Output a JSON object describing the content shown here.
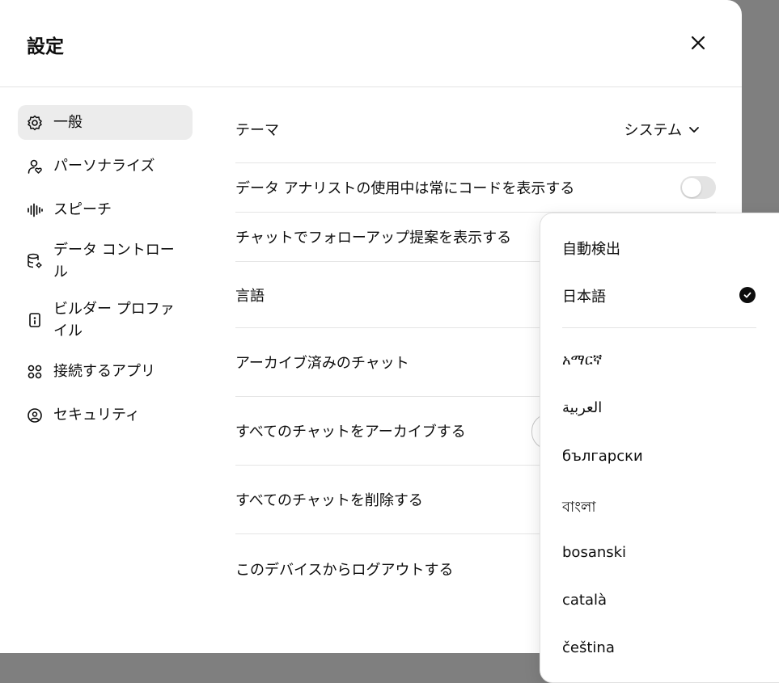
{
  "dialog": {
    "title": "設定"
  },
  "sidebar": {
    "items": [
      {
        "label": "一般",
        "icon": "gear-icon",
        "active": true
      },
      {
        "label": "パーソナライズ",
        "icon": "person-heart-icon"
      },
      {
        "label": "スピーチ",
        "icon": "waveform-icon"
      },
      {
        "label": "データ コントロール",
        "icon": "database-gear-icon"
      },
      {
        "label": "ビルダー プロファイル",
        "icon": "id-badge-icon"
      },
      {
        "label": "接続するアプリ",
        "icon": "apps-grid-icon"
      },
      {
        "label": "セキュリティ",
        "icon": "shield-lock-icon"
      }
    ]
  },
  "settings": {
    "theme": {
      "label": "テーマ",
      "value": "システム"
    },
    "code": {
      "label": "データ アナリストの使用中は常にコードを表示する",
      "enabled": false
    },
    "follow": {
      "label": "チャットでフォローアップ提案を表示する"
    },
    "language": {
      "label": "言語"
    },
    "archived": {
      "label": "アーカイブ済みのチャット"
    },
    "archive_all": {
      "label": "すべてのチャットをアーカイブする"
    },
    "delete_all": {
      "label": "すべてのチャットを削除する"
    },
    "logout": {
      "label": "このデバイスからログアウトする"
    }
  },
  "language_dropdown": {
    "options": [
      "自動検出",
      "日本語",
      "አማርኛ",
      "العربية",
      "български",
      "বাংলা",
      "bosanski",
      "català",
      "čeština"
    ],
    "selected": "日本語"
  }
}
